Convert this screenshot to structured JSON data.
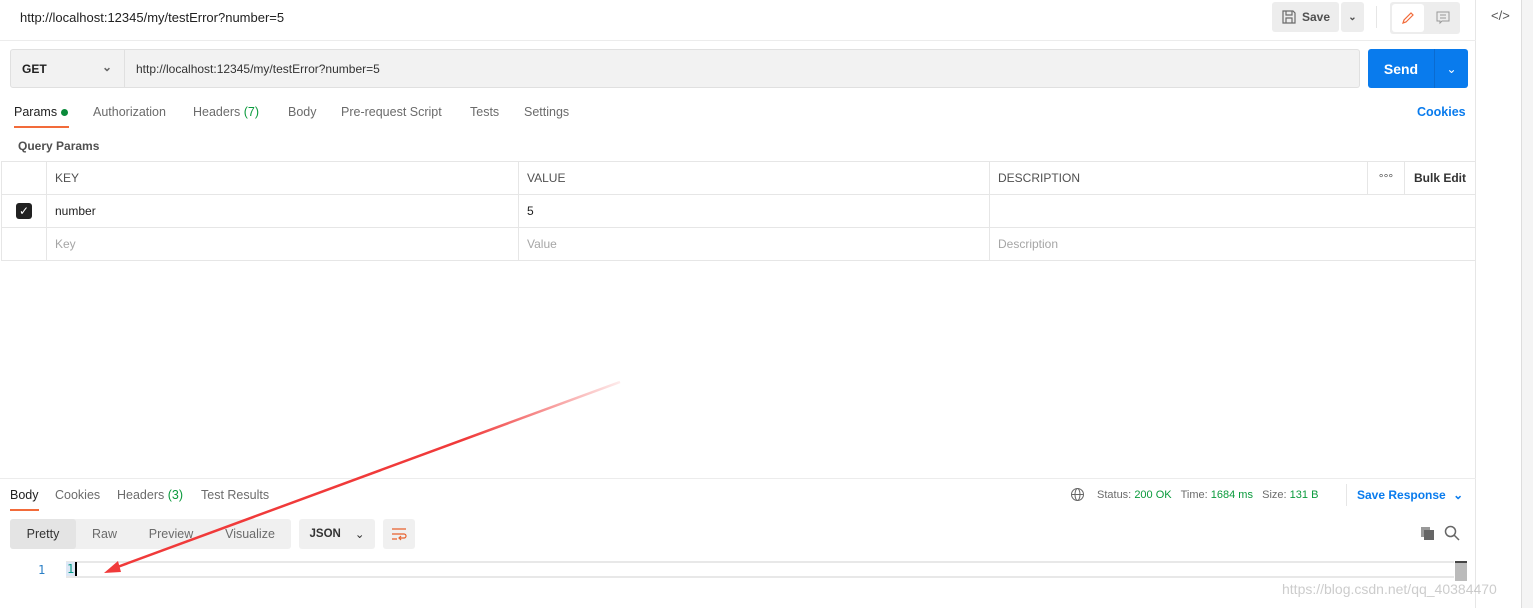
{
  "header": {
    "title": "http://localhost:12345/my/testError?number=5",
    "save_label": "Save"
  },
  "request": {
    "method": "GET",
    "url": "http://localhost:12345/my/testError?number=5",
    "send_label": "Send"
  },
  "tabs": [
    {
      "label": "Params"
    },
    {
      "label": "Authorization"
    },
    {
      "label": "Headers",
      "count": "(7)"
    },
    {
      "label": "Body"
    },
    {
      "label": "Pre-request Script"
    },
    {
      "label": "Tests"
    },
    {
      "label": "Settings"
    }
  ],
  "cookies_label": "Cookies",
  "query_params": {
    "title": "Query Params",
    "columns": [
      "KEY",
      "VALUE",
      "DESCRIPTION"
    ],
    "bulk_edit": "Bulk Edit",
    "rows": [
      {
        "checked": true,
        "key": "number",
        "value": "5",
        "description": ""
      }
    ],
    "placeholders": {
      "key": "Key",
      "value": "Value",
      "description": "Description"
    }
  },
  "response": {
    "tabs": [
      {
        "label": "Body"
      },
      {
        "label": "Cookies"
      },
      {
        "label": "Headers",
        "count": "(3)"
      },
      {
        "label": "Test Results"
      }
    ],
    "status_label": "Status:",
    "status": "200 OK",
    "time_label": "Time:",
    "time": "1684 ms",
    "size_label": "Size:",
    "size": "131 B",
    "save_response": "Save Response",
    "views": [
      "Pretty",
      "Raw",
      "Preview",
      "Visualize"
    ],
    "format": "JSON",
    "lines": [
      {
        "num": "1",
        "text": "1"
      }
    ]
  },
  "watermark": "https://blog.csdn.net/qq_40384470",
  "colors": {
    "accent": "#097bed",
    "active_tab": "#f26b3a",
    "success": "#0a9a3c",
    "annotation_arrow": "#f03a3a"
  }
}
